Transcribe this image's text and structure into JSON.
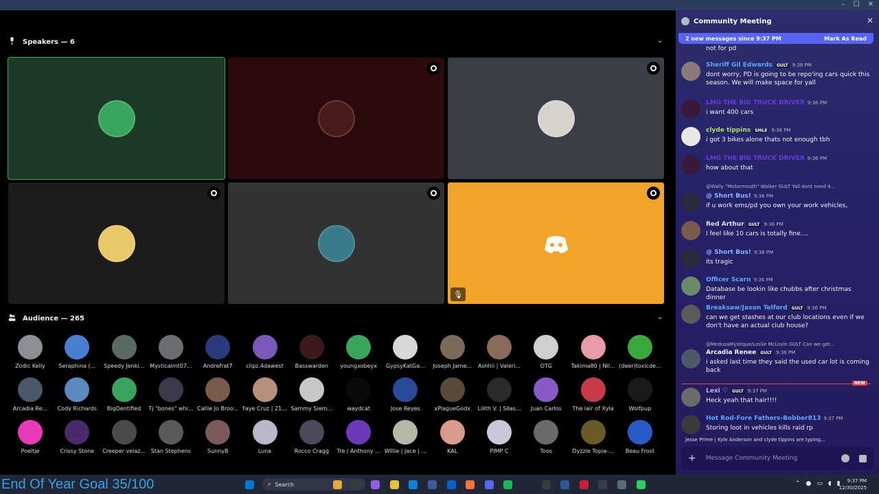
{
  "window": {
    "minimize": "–",
    "maximize": "☐",
    "close": "✕"
  },
  "stage": {
    "speakers_label": "Speakers — 6",
    "audience_label": "Audience — 265",
    "tiles": [
      {
        "bg": "#1e3a26",
        "avatar": "#3aa55d",
        "active": true,
        "badge": false
      },
      {
        "bg": "#2a0a0a",
        "avatar": "#4a1a1a",
        "active": false,
        "badge": true
      },
      {
        "bg": "#3a3f47",
        "avatar": "#d8d2cc",
        "active": false,
        "badge": true
      },
      {
        "bg": "#1c1c1c",
        "avatar": "#e8c868",
        "active": false,
        "badge": true
      },
      {
        "bg": "#303234",
        "avatar": "#3a7a8a",
        "active": false,
        "badge": true
      },
      {
        "bg": "#f0a52a",
        "avatar": "#f0a52a",
        "active": false,
        "badge": true,
        "discord": true,
        "muted": true
      }
    ],
    "audience": [
      {
        "name": "Zodic Kelly",
        "color": "#8a8f98"
      },
      {
        "name": "Seraphina (...",
        "color": "#4a7fd0"
      },
      {
        "name": "Speedy Jenki...",
        "color": "#5a6b62"
      },
      {
        "name": "Mysticalmt07...",
        "color": "#6a6e72"
      },
      {
        "name": "Andrefrat7",
        "color": "#2a3a7a"
      },
      {
        "name": "clipz.4dawest",
        "color": "#7a5ab8"
      },
      {
        "name": "Basswarden",
        "color": "#3a1a1a"
      },
      {
        "name": "youngxobeyx",
        "color": "#3ba55d"
      },
      {
        "name": "GypsyKatGa...",
        "color": "#d8d8d8"
      },
      {
        "name": "Joseph Jame...",
        "color": "#7a6a5a"
      },
      {
        "name": "Ashhii | Valeri...",
        "color": "#8a6a5a"
      },
      {
        "name": "OTG",
        "color": "#cfcfcf"
      },
      {
        "name": "Takima80 | Nil...",
        "color": "#e89aa8"
      },
      {
        "name": "(deer)toxicde...",
        "color": "#3aa83a"
      },
      {
        "name": "Arcadia Re...",
        "color": "#4a5a6a"
      },
      {
        "name": "Cody Richards",
        "color": "#5a8ac0"
      },
      {
        "name": "BigDentified",
        "color": "#3ba55d"
      },
      {
        "name": "Tj \"bones\" whi...",
        "color": "#3a3a4a"
      },
      {
        "name": "Callie Jo Broo...",
        "color": "#7a5a4a"
      },
      {
        "name": "Faye Cruz | 21...",
        "color": "#b8907a"
      },
      {
        "name": "Sammy Siem...",
        "color": "#c8c8c8"
      },
      {
        "name": "waydcat",
        "color": "#0a0a0a"
      },
      {
        "name": "Jose Reyes",
        "color": "#2a4a9a"
      },
      {
        "name": "xPlagueGodx",
        "color": "#5a4a3a"
      },
      {
        "name": "Lilith V. | Silas...",
        "color": "#2a2a2a"
      },
      {
        "name": "Juan Carlos",
        "color": "#8a5ac8"
      },
      {
        "name": "The lair of Xyla",
        "color": "#c83a4a"
      },
      {
        "name": "Wolfpup",
        "color": "#1a1a1a"
      },
      {
        "name": "Poeltje",
        "color": "#e83ab8"
      },
      {
        "name": "Crissy Stone",
        "color": "#4a2a6a"
      },
      {
        "name": "Creeper velaz...",
        "color": "#4a4a4a"
      },
      {
        "name": "Stan Stephens",
        "color": "#5a5a5a"
      },
      {
        "name": "SunnyB",
        "color": "#7a5a5a"
      },
      {
        "name": "Luna",
        "color": "#b8b8c8"
      },
      {
        "name": "Rocco Cragg",
        "color": "#4a4a5a"
      },
      {
        "name": "Tre / Anthony ...",
        "color": "#6a3ab8"
      },
      {
        "name": "Willie | Jace | ...",
        "color": "#b8b8a8"
      },
      {
        "name": "KAL",
        "color": "#d89a8a"
      },
      {
        "name": "PIMP C",
        "color": "#c8c8d8"
      },
      {
        "name": "Toos",
        "color": "#6a6a6a"
      },
      {
        "name": "Dyzzle Topia-...",
        "color": "#6a5a2a"
      },
      {
        "name": "Beau Frost",
        "color": "#2a5ac8"
      }
    ]
  },
  "chat": {
    "title": "Community Meeting",
    "close": "✕",
    "new_messages": "2 new messages since 9:37 PM",
    "mark_read": "Mark As Read",
    "new_label": "NEW",
    "typing": "Jesse Prime | Kyle Anderson and clyde tippins are typing...",
    "placeholder": "Message Community Meeting",
    "top_body": "not for pd",
    "messages": [
      {
        "author": "Sheriff Gil Edwards",
        "color": "#57a8ff",
        "tag": "GULT",
        "time": "9:36 PM",
        "body": "dont worry, PD is going to be repo'ing cars quick this season. We will make space for yall",
        "av": "#8a7a7a"
      },
      {
        "author": "LMG THE BIG TRUCK DRIVER",
        "color": "#6a3ad8",
        "tag": "",
        "time": "9:36 PM",
        "body": "i want 400 cars",
        "av": "#3a1a3a"
      },
      {
        "author": "clyde tippins",
        "color": "#a8e060",
        "tag": "SMLE",
        "time": "9:36 PM",
        "body": "i got 3 bikes alone thats not enough tbh",
        "av": "#e8e8e8"
      },
      {
        "author": "LMG THE BIG TRUCK DRIVER",
        "color": "#6a3ad8",
        "tag": "",
        "time": "9:36 PM",
        "body": "how about that",
        "av": "#3a1a3a"
      },
      {
        "author": "@ Short Bus!",
        "color": "#8ab4ff",
        "tag": "",
        "time": "9:36 PM",
        "body": "if u work ems/pd you own your work vehicles,",
        "av": "#2a2a3a"
      },
      {
        "author": "Red Arthur",
        "color": "#dbdee1",
        "tag": "GULT",
        "time": "9:36 PM",
        "body": "I feel like 10 cars is totally fine....",
        "av": "#7a5a4a"
      },
      {
        "author": "@ Short Bus!",
        "color": "#8ab4ff",
        "tag": "",
        "time": "9:36 PM",
        "body": "its tragic",
        "av": "#2a2a3a"
      },
      {
        "author": "Officer Scarn",
        "color": "#57a8ff",
        "tag": "",
        "time": "9:36 PM",
        "body": "Database be lookin like chubbs after christmas dinner",
        "av": "#6a8a6a"
      },
      {
        "author": "Breaksaw/Jaxon Telford",
        "color": "#57a8ff",
        "tag": "GULT",
        "time": "9:36 PM",
        "body": "can we get stashes at our club locations even if we don't have an actual club house?",
        "av": "#5a5a5a"
      },
      {
        "author": "Arcadia Renee",
        "color": "#f2f3f5",
        "tag": "GULT",
        "time": "9:36 PM",
        "body": "i asked last time they said the used car lot is coming back",
        "av": "#4a5a6a"
      },
      {
        "author": "Lexi ♡",
        "color": "#c8a8ff",
        "tag": "GULT",
        "time": "9:37 PM",
        "body": "Heck yeah that hair!!!!",
        "av": "#6a6a6a"
      },
      {
        "author": "Hot Rod-Fore Fathers-Bobber813",
        "color": "#57a8ff",
        "tag": "",
        "time": "9:37 PM",
        "body": "Storing loot in vehicles kills raid rp",
        "av": "#3a3a3a"
      }
    ],
    "replies": [
      {
        "text": "@Wally \"Motormouth\" Walker  GULT  Yall dont need 4..."
      },
      {
        "text": "@MedusaMystique/Leslie McLovin  GULT  Can we get..."
      }
    ]
  },
  "taskbar": {
    "goal": "End Of Year Goal 35/100",
    "search": "Search",
    "time": "9:37 PM",
    "date": "12/30/2025"
  }
}
